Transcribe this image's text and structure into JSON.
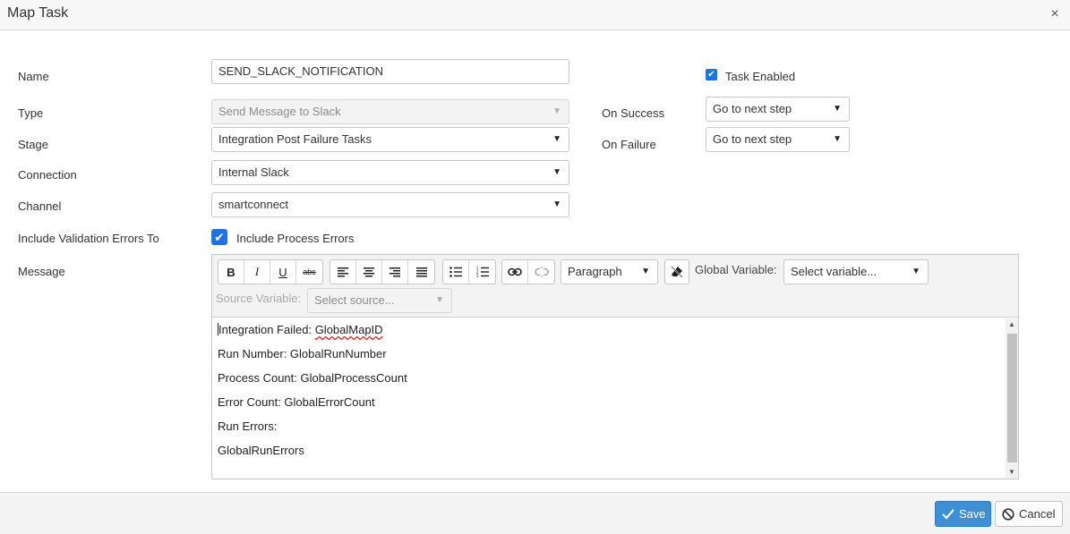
{
  "dialog": {
    "title": "Map Task",
    "close_glyph": "×"
  },
  "form": {
    "name_label": "Name",
    "name_value": "SEND_SLACK_NOTIFICATION",
    "type_label": "Type",
    "type_value": "Send Message to Slack",
    "stage_label": "Stage",
    "stage_value": "Integration Post Failure Tasks",
    "connection_label": "Connection",
    "connection_value": "Internal Slack",
    "channel_label": "Channel",
    "channel_value": "smartconnect",
    "include_validation_label": "Include Validation Errors To",
    "include_process_errors_label": "Include Process Errors",
    "message_label": "Message",
    "task_enabled_label": "Task Enabled",
    "on_success_label": "On Success",
    "on_success_value": "Go to next step",
    "on_failure_label": "On Failure",
    "on_failure_value": "Go to next step"
  },
  "editor": {
    "toolbar": {
      "paragraph_value": "Paragraph",
      "global_variable_label": "Global Variable:",
      "global_variable_placeholder": "Select variable...",
      "source_variable_label": "Source Variable:",
      "source_variable_placeholder": "Select source..."
    },
    "lines": [
      {
        "prefix": "Integration Failed: ",
        "var": "GlobalMapID"
      },
      {
        "prefix": "Run Number: ",
        "var": "GlobalRunNumber"
      },
      {
        "prefix": "Process Count: ",
        "var": "GlobalProcessCount"
      },
      {
        "prefix": "Error Count: ",
        "var": "GlobalErrorCount"
      },
      {
        "prefix": "Run Errors:",
        "var": ""
      },
      {
        "prefix": "",
        "var": "GlobalRunErrors"
      }
    ]
  },
  "footer": {
    "save_label": "Save",
    "cancel_label": "Cancel"
  },
  "colors": {
    "accent": "#1a73e8",
    "save_button": "#3d8fd6"
  }
}
